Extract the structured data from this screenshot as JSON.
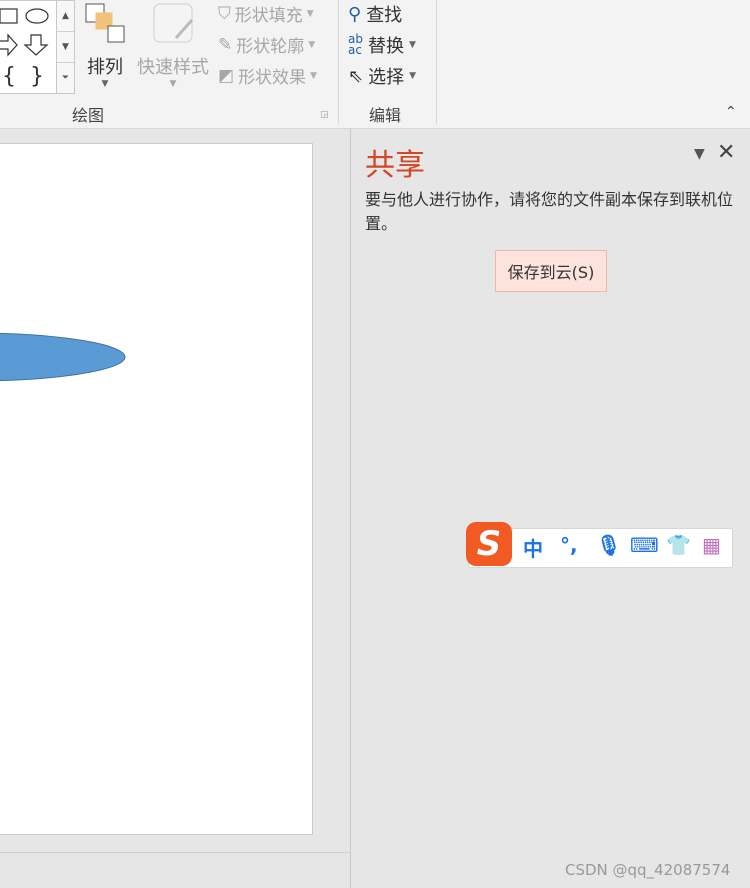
{
  "ribbon": {
    "arrange_label": "排列",
    "quick_styles_label": "快速样式",
    "shape_fill_label": "形状填充",
    "shape_outline_label": "形状轮廓",
    "shape_effects_label": "形状效果",
    "drawing_group_label": "绘图",
    "find_label": "查找",
    "replace_label": "替换",
    "select_label": "选择",
    "editing_group_label": "编辑"
  },
  "shapes_gallery": {
    "items": [
      "rectangle",
      "oval",
      "right-arrow",
      "down-arrow",
      "left-brace",
      "right-brace"
    ],
    "brace_left": "{",
    "brace_right": "}"
  },
  "slide": {
    "shape": {
      "type": "ellipse",
      "fill": "#5b9bd5",
      "stroke": "#41719c"
    }
  },
  "share_pane": {
    "title": "共享",
    "message": "要与他人进行协作，请将您的文件副本保存到联机位置。",
    "save_button_label": "保存到云(S)",
    "accent_color": "#d24726"
  },
  "ime_toolbar": {
    "logo_text": "S",
    "mode_label": "中",
    "punct_label": "°,",
    "items": [
      "voice-icon",
      "keyboard-icon",
      "skin-icon",
      "toolbox-icon"
    ]
  },
  "watermark": "CSDN @qq_42087574"
}
